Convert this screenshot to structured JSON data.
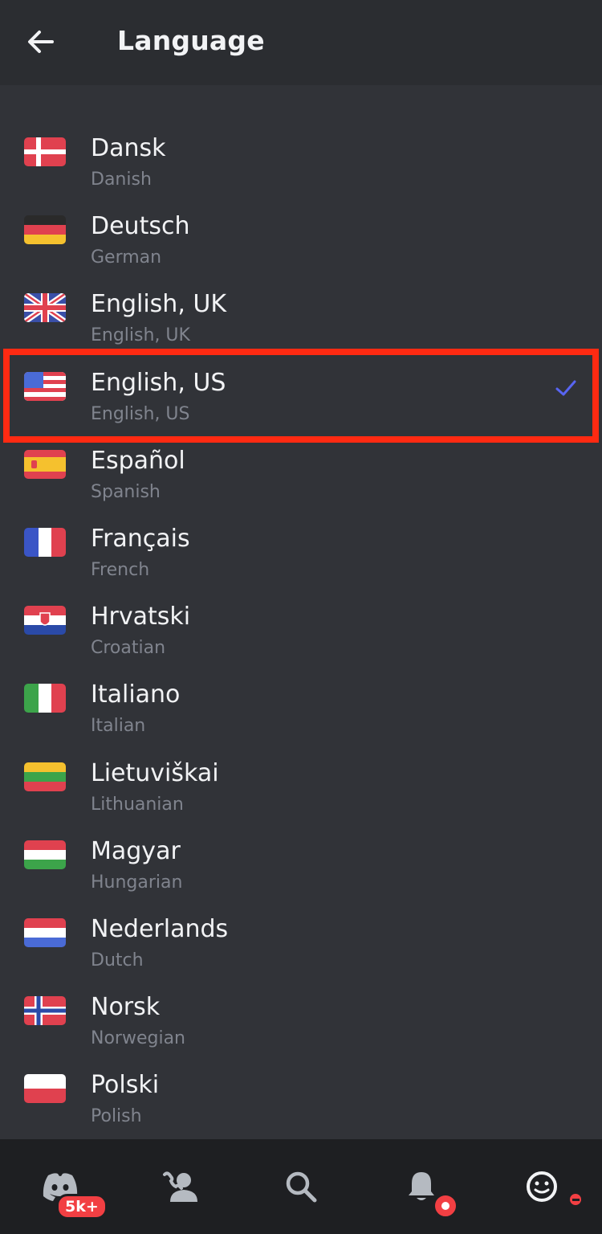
{
  "header": {
    "title": "Language",
    "back_icon": "arrow-left-icon"
  },
  "languages": [
    {
      "name": "Dansk",
      "native": "Danish",
      "flag": "flag-denmark-icon",
      "selected": false
    },
    {
      "name": "Deutsch",
      "native": "German",
      "flag": "flag-germany-icon",
      "selected": false
    },
    {
      "name": "English, UK",
      "native": "English, UK",
      "flag": "flag-uk-icon",
      "selected": false
    },
    {
      "name": "English, US",
      "native": "English, US",
      "flag": "flag-us-icon",
      "selected": true
    },
    {
      "name": "Español",
      "native": "Spanish",
      "flag": "flag-spain-icon",
      "selected": false
    },
    {
      "name": "Français",
      "native": "French",
      "flag": "flag-france-icon",
      "selected": false
    },
    {
      "name": "Hrvatski",
      "native": "Croatian",
      "flag": "flag-croatia-icon",
      "selected": false
    },
    {
      "name": "Italiano",
      "native": "Italian",
      "flag": "flag-italy-icon",
      "selected": false
    },
    {
      "name": "Lietuviškai",
      "native": "Lithuanian",
      "flag": "flag-lithuania-icon",
      "selected": false
    },
    {
      "name": "Magyar",
      "native": "Hungarian",
      "flag": "flag-hungary-icon",
      "selected": false
    },
    {
      "name": "Nederlands",
      "native": "Dutch",
      "flag": "flag-netherlands-icon",
      "selected": false
    },
    {
      "name": "Norsk",
      "native": "Norwegian",
      "flag": "flag-norway-icon",
      "selected": false
    },
    {
      "name": "Polski",
      "native": "Polish",
      "flag": "flag-poland-icon",
      "selected": false
    }
  ],
  "bottom_nav": {
    "tabs": [
      {
        "icon": "discord-home-icon",
        "badge": "5k+"
      },
      {
        "icon": "friends-icon"
      },
      {
        "icon": "search-icon"
      },
      {
        "icon": "bell-icon"
      },
      {
        "icon": "profile-icon"
      }
    ]
  },
  "colors": {
    "background": "#313338",
    "header": "#2b2d31",
    "nav": "#1e1f22",
    "text_primary": "#f2f3f5",
    "text_secondary": "#80848e",
    "check": "#5865f2",
    "highlight": "#ff2a12",
    "badge": "#f23f43"
  }
}
